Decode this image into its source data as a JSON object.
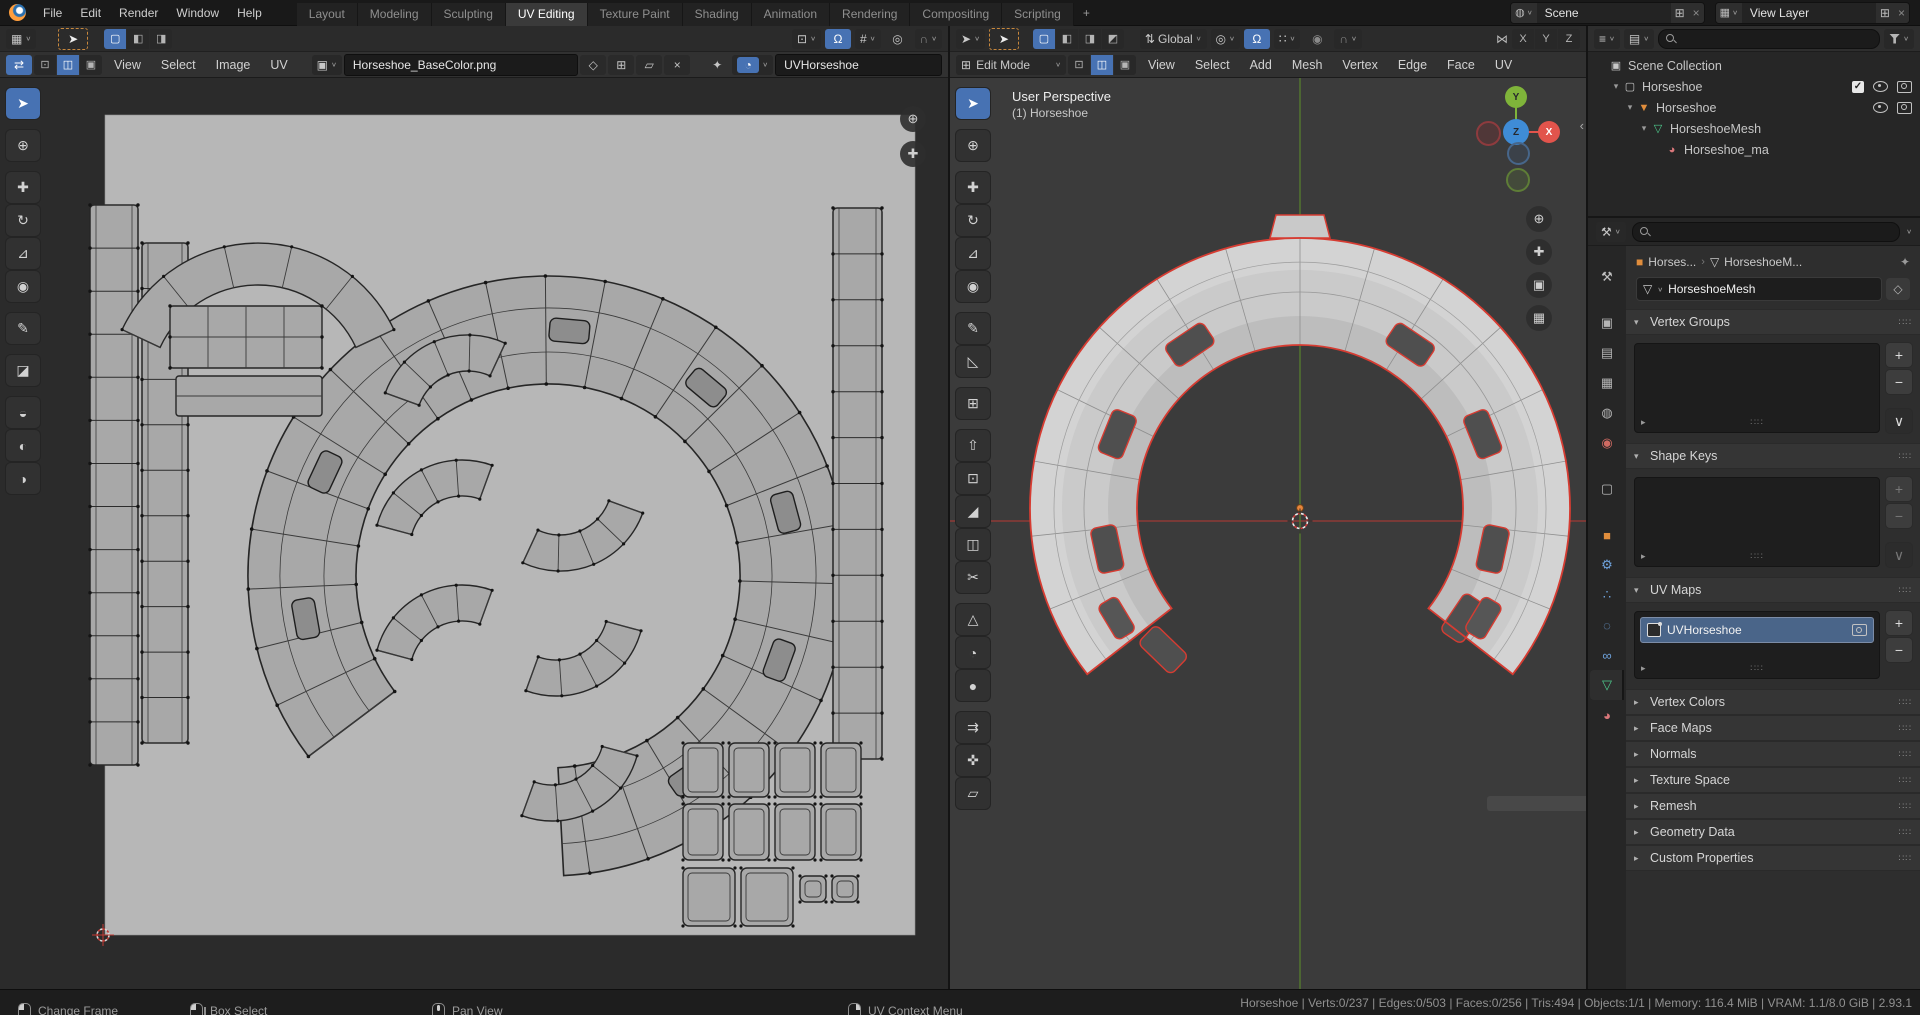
{
  "topbar": {
    "menus": [
      "File",
      "Edit",
      "Render",
      "Window",
      "Help"
    ],
    "workspaces": [
      {
        "label": "Layout"
      },
      {
        "label": "Modeling"
      },
      {
        "label": "Sculpting"
      },
      {
        "label": "UV Editing",
        "active": true
      },
      {
        "label": "Texture Paint"
      },
      {
        "label": "Shading"
      },
      {
        "label": "Animation"
      },
      {
        "label": "Rendering"
      },
      {
        "label": "Compositing"
      },
      {
        "label": "Scripting"
      }
    ],
    "workspace_add": "+",
    "scene_field": "Scene",
    "view_layer_field": "View Layer"
  },
  "uv_editor": {
    "menus": [
      "View",
      "Select",
      "Image",
      "UV"
    ],
    "image_name": "Horseshoe_BaseColor.png",
    "uv_map_field": "UVHorseshoe",
    "tools": [
      {
        "name": "select-box",
        "glyph": "➤",
        "active": true
      },
      {
        "name": "cursor",
        "glyph": "⊕",
        "gap": true
      },
      {
        "name": "move",
        "glyph": "✚",
        "gap": true
      },
      {
        "name": "rotate",
        "glyph": "↻"
      },
      {
        "name": "scale",
        "glyph": "⊿"
      },
      {
        "name": "transform",
        "glyph": "◉"
      },
      {
        "name": "annotate",
        "glyph": "✎",
        "gap": true
      },
      {
        "name": "rip-region",
        "glyph": "◪",
        "gap": true
      },
      {
        "name": "grab",
        "glyph": "◒",
        "gap": true
      },
      {
        "name": "relax",
        "glyph": "◐"
      },
      {
        "name": "pinch",
        "glyph": "◑"
      }
    ]
  },
  "viewport": {
    "overlay": {
      "line1": "User Perspective",
      "line2": "(1) Horseshoe"
    },
    "mode": "Edit Mode",
    "orientation": "Global",
    "menus": [
      "View",
      "Select",
      "Add",
      "Mesh",
      "Vertex",
      "Edge",
      "Face",
      "UV"
    ],
    "mirror": [
      "X",
      "Y",
      "Z"
    ],
    "gizmo": {
      "x": "X",
      "y": "Y",
      "z": "Z"
    },
    "tools": [
      {
        "name": "select-box",
        "glyph": "➤",
        "active": true
      },
      {
        "name": "cursor",
        "glyph": "⊕",
        "gap": true
      },
      {
        "name": "move",
        "glyph": "✚",
        "gap": true
      },
      {
        "name": "rotate",
        "glyph": "↻"
      },
      {
        "name": "scale",
        "glyph": "⊿"
      },
      {
        "name": "transform",
        "glyph": "◉"
      },
      {
        "name": "annotate",
        "glyph": "✎",
        "gap": true
      },
      {
        "name": "measure",
        "glyph": "◺"
      },
      {
        "name": "add-cube",
        "glyph": "⊞",
        "gap": true
      },
      {
        "name": "extrude-region",
        "glyph": "⇧",
        "gap": true
      },
      {
        "name": "inset-faces",
        "glyph": "⊡"
      },
      {
        "name": "bevel",
        "glyph": "◢"
      },
      {
        "name": "loop-cut",
        "glyph": "◫"
      },
      {
        "name": "knife",
        "glyph": "✂"
      },
      {
        "name": "poly-build",
        "glyph": "△",
        "gap": true
      },
      {
        "name": "spin",
        "glyph": "◔"
      },
      {
        "name": "smooth",
        "glyph": "●"
      },
      {
        "name": "edge-slide",
        "glyph": "⇉",
        "gap": true
      },
      {
        "name": "shrink-fatten",
        "glyph": "✜"
      },
      {
        "name": "shear",
        "glyph": "▱"
      }
    ]
  },
  "outliner": {
    "rows": [
      {
        "label": "Scene Collection",
        "icon": "scene-collection",
        "glyph": "▣",
        "color": "#c8c8c8",
        "depth": 0,
        "expander": false,
        "toggles": []
      },
      {
        "label": "Horseshoe",
        "icon": "collection",
        "glyph": "▢",
        "color": "#c8c8c8",
        "depth": 1,
        "expander": true,
        "toggles": [
          "checkbox",
          "eye",
          "camera"
        ]
      },
      {
        "label": "Horseshoe",
        "icon": "object",
        "glyph": "▼",
        "color": "#e08d3c",
        "depth": 2,
        "expander": true,
        "toggles": [
          "eye",
          "camera"
        ]
      },
      {
        "label": "HorseshoeMesh",
        "icon": "mesh-data",
        "glyph": "▽",
        "color": "#4ecb8d",
        "depth": 3,
        "expander": true,
        "toggles": []
      },
      {
        "label": "Horseshoe_ma",
        "icon": "material",
        "glyph": "◕",
        "color": "#d9777a",
        "depth": 4,
        "expander": false,
        "toggles": []
      }
    ]
  },
  "properties": {
    "tabs": [
      {
        "name": "tool",
        "glyph": "⚒",
        "color": "#c0c0c0"
      },
      {
        "name": "render",
        "glyph": "▣",
        "color": "#b5b5b5",
        "group": true
      },
      {
        "name": "output",
        "glyph": "▤",
        "color": "#b5b5b5"
      },
      {
        "name": "view-layer",
        "glyph": "▦",
        "color": "#b5b5b5"
      },
      {
        "name": "scene",
        "glyph": "◍",
        "color": "#b5b5b5"
      },
      {
        "name": "world",
        "glyph": "◉",
        "color": "#cf6a62"
      },
      {
        "name": "collection",
        "glyph": "▢",
        "color": "#b5b5b5",
        "group": true
      },
      {
        "name": "object",
        "glyph": "■",
        "color": "#e08d3c",
        "group": true
      },
      {
        "name": "modifiers",
        "glyph": "⚙",
        "color": "#6fa3dd"
      },
      {
        "name": "particles",
        "glyph": "∴",
        "color": "#6fa3dd"
      },
      {
        "name": "physics",
        "glyph": "◌",
        "color": "#6fa3dd"
      },
      {
        "name": "constraints",
        "glyph": "∞",
        "color": "#6fa3dd"
      },
      {
        "name": "object-data",
        "glyph": "▽",
        "color": "#4ecb8d",
        "active": true
      },
      {
        "name": "material",
        "glyph": "◕",
        "color": "#d9777a"
      }
    ],
    "breadcrumb": {
      "object": "Horses...",
      "data": "HorseshoeM..."
    },
    "name_field": "HorseshoeMesh",
    "panels": [
      {
        "title": "Vertex Groups",
        "state": "expanded",
        "kind": "list",
        "buttons": [
          "add",
          "remove",
          "specials"
        ]
      },
      {
        "title": "Shape Keys",
        "state": "expanded",
        "kind": "list",
        "buttons": [
          "add",
          "remove",
          "specials"
        ],
        "muted": true
      },
      {
        "title": "UV Maps",
        "state": "expanded",
        "kind": "uv-list",
        "items": [
          {
            "label": "UVHorseshoe",
            "selected": true
          }
        ],
        "buttons": [
          "add",
          "remove"
        ]
      },
      {
        "title": "Vertex Colors",
        "state": "collapsed"
      },
      {
        "title": "Face Maps",
        "state": "collapsed"
      },
      {
        "title": "Normals",
        "state": "collapsed"
      },
      {
        "title": "Texture Space",
        "state": "collapsed"
      },
      {
        "title": "Remesh",
        "state": "collapsed"
      },
      {
        "title": "Geometry Data",
        "state": "collapsed"
      },
      {
        "title": "Custom Properties",
        "state": "collapsed"
      }
    ]
  },
  "statusbar": {
    "hints": [
      {
        "button": "left",
        "label": "Change Frame"
      },
      {
        "button": "left-drag",
        "label": "Box Select"
      },
      {
        "button": "middle",
        "label": "Pan View"
      },
      {
        "button": "right",
        "label": "UV Context Menu"
      }
    ],
    "stats": "Horseshoe | Verts:0/237 | Edges:0/503 | Faces:0/256 | Tris:494 | Objects:1/1 | Memory: 116.4 MiB | VRAM: 1.1/8.0 GiB | 2.93.1"
  },
  "colors": {
    "accent": "#4772b3",
    "seam_red": "#d63c32",
    "axis_x": "#e2544c",
    "axis_y": "#7fb43a",
    "axis_z": "#3f8cd6",
    "selection": "#4a6589"
  }
}
